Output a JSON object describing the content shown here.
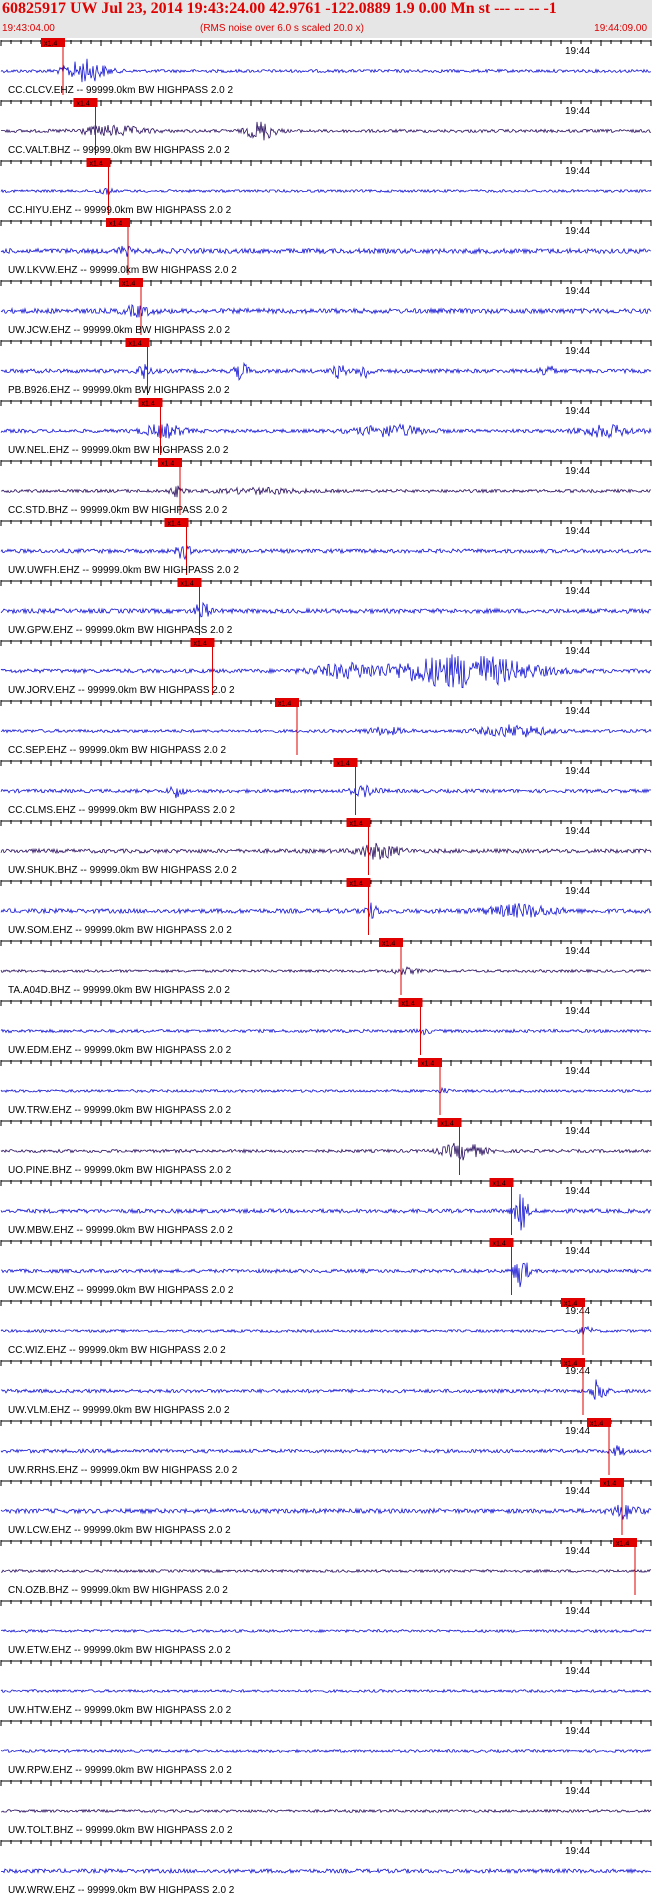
{
  "header": {
    "title": "60825917 UW Jul 23, 2014 19:43:24.00   42.9761 -122.0889  1.9 0.00 Mn st --- -- --  -1",
    "start_time": "19:43:04.00",
    "note": "(RMS noise over 6.0 s scaled 20.0 x)",
    "end_time": "19:44:09.00"
  },
  "time_marker": "19:44",
  "pick_label": "x1.4",
  "colors": {
    "header_text": "#e00000",
    "header_bg": "#e6e6e6",
    "blue": "#1414d2",
    "dark": "#2a1060",
    "pick": "#e00000"
  },
  "traces": [
    {
      "label": "CC.CLCV.EHZ -- 99999.0km BW  HIGHPASS  2.0  2",
      "color": "blue",
      "pick": 0.08,
      "amp": 0.35,
      "bursts": [
        [
          0.13,
          0.03,
          7
        ]
      ]
    },
    {
      "label": "CC.VALT.BHZ -- 99999.0km BW  HIGHPASS  2.0  2",
      "color": "dark",
      "pick": 0.13,
      "amp": 0.35,
      "bursts": [
        [
          0.17,
          0.05,
          3
        ],
        [
          0.4,
          0.02,
          6
        ]
      ]
    },
    {
      "label": "CC.HIYU.EHZ -- 99999.0km BW  HIGHPASS  2.0  2",
      "color": "blue",
      "pick": 0.15,
      "amp": 0.3,
      "bursts": [
        [
          0.16,
          0.01,
          2.5
        ]
      ]
    },
    {
      "label": "UW.LKVW.EHZ -- 99999.0km BW  HIGHPASS  2.0  2",
      "color": "blue",
      "pick": 0.18,
      "amp": 0.55,
      "bursts": [
        [
          0.19,
          0.01,
          1.5
        ]
      ]
    },
    {
      "label": "UW.JCW.EHZ -- 99999.0km BW  HIGHPASS  2.0  2",
      "color": "blue",
      "pick": 0.2,
      "amp": 0.55,
      "bursts": [
        [
          0.21,
          0.02,
          1.8
        ]
      ]
    },
    {
      "label": "PB.B926.EHZ -- 99999.0km BW  HIGHPASS  2.0  2",
      "color": "blue",
      "pick": 0.21,
      "amp": 0.45,
      "bursts": [
        [
          0.22,
          0.01,
          3.5
        ],
        [
          0.37,
          0.01,
          4
        ],
        [
          0.52,
          0.01,
          3
        ],
        [
          0.56,
          0.01,
          3.5
        ],
        [
          0.84,
          0.01,
          3
        ]
      ]
    },
    {
      "label": "UW.NEL.EHZ -- 99999.0km BW  HIGHPASS  2.0  2",
      "color": "blue",
      "pick": 0.23,
      "amp": 0.4,
      "bursts": [
        [
          0.25,
          0.03,
          3.5
        ],
        [
          0.6,
          0.05,
          3
        ],
        [
          0.93,
          0.04,
          3
        ]
      ]
    },
    {
      "label": "CC.STD.BHZ -- 99999.0km BW  HIGHPASS  2.0  2",
      "color": "dark",
      "pick": 0.26,
      "amp": 0.35,
      "bursts": [
        [
          0.27,
          0.01,
          3
        ],
        [
          0.4,
          0.06,
          1.5
        ]
      ]
    },
    {
      "label": "UW.UWFH.EHZ -- 99999.0km BW  HIGHPASS  2.0  2",
      "color": "blue",
      "pick": 0.27,
      "amp": 0.45,
      "bursts": [
        [
          0.28,
          0.01,
          3.5
        ]
      ]
    },
    {
      "label": "UW.GPW.EHZ -- 99999.0km BW  HIGHPASS  2.0  2",
      "color": "blue",
      "pick": 0.29,
      "amp": 0.5,
      "bursts": [
        [
          0.31,
          0.01,
          4
        ]
      ]
    },
    {
      "label": "UW.JORV.EHZ -- 99999.0km BW  HIGHPASS  2.0  2",
      "color": "blue",
      "pick": 0.31,
      "amp": 0.45,
      "bursts": [
        [
          0.71,
          0.1,
          8
        ],
        [
          0.53,
          0.05,
          3
        ]
      ]
    },
    {
      "label": "CC.SEP.EHZ -- 99999.0km BW  HIGHPASS  2.0  2",
      "color": "blue",
      "pick": 0.44,
      "amp": 0.35,
      "bursts": [
        [
          0.79,
          0.05,
          3.5
        ],
        [
          0.59,
          0.03,
          2
        ]
      ]
    },
    {
      "label": "CC.CLMS.EHZ -- 99999.0km BW  HIGHPASS  2.0  2",
      "color": "blue",
      "pick": 0.53,
      "amp": 0.4,
      "bursts": [
        [
          0.27,
          0.01,
          3.5
        ],
        [
          0.56,
          0.02,
          2.5
        ]
      ]
    },
    {
      "label": "UW.SHUK.BHZ -- 99999.0km BW  HIGHPASS  2.0  2",
      "color": "dark",
      "pick": 0.55,
      "amp": 0.45,
      "bursts": [
        [
          0.58,
          0.03,
          3.5
        ]
      ]
    },
    {
      "label": "UW.SOM.EHZ -- 99999.0km BW  HIGHPASS  2.0  2",
      "color": "blue",
      "pick": 0.55,
      "amp": 0.5,
      "bursts": [
        [
          0.57,
          0.01,
          3
        ],
        [
          0.8,
          0.05,
          2.5
        ]
      ]
    },
    {
      "label": "TA.A04D.BHZ -- 99999.0km BW  HIGHPASS  2.0  2",
      "color": "dark",
      "pick": 0.6,
      "amp": 0.3,
      "bursts": [
        [
          0.62,
          0.02,
          2
        ]
      ]
    },
    {
      "label": "UW.EDM.EHZ -- 99999.0km BW  HIGHPASS  2.0  2",
      "color": "blue",
      "pick": 0.63,
      "amp": 0.35,
      "bursts": [
        [
          0.65,
          0.01,
          1.5
        ]
      ]
    },
    {
      "label": "UW.TRW.EHZ -- 99999.0km BW  HIGHPASS  2.0  2",
      "color": "blue",
      "pick": 0.66,
      "amp": 0.3,
      "bursts": [
        [
          0.68,
          0.01,
          1.5
        ]
      ]
    },
    {
      "label": "UO.PINE.BHZ -- 99999.0km BW  HIGHPASS  2.0  2",
      "color": "dark",
      "pick": 0.69,
      "amp": 0.35,
      "bursts": [
        [
          0.71,
          0.03,
          5
        ]
      ]
    },
    {
      "label": "UW.MBW.EHZ -- 99999.0km BW  HIGHPASS  2.0  2",
      "color": "blue",
      "pick": 0.77,
      "amp": 0.45,
      "bursts": [
        [
          0.8,
          0.01,
          9
        ]
      ]
    },
    {
      "label": "UW.MCW.EHZ -- 99999.0km BW  HIGHPASS  2.0  2",
      "color": "blue",
      "pick": 0.77,
      "amp": 0.4,
      "bursts": [
        [
          0.8,
          0.01,
          9
        ]
      ]
    },
    {
      "label": "CC.WIZ.EHZ -- 99999.0km BW  HIGHPASS  2.0  2",
      "color": "blue",
      "pick": 0.88,
      "amp": 0.3,
      "bursts": [
        [
          0.9,
          0.01,
          3
        ]
      ]
    },
    {
      "label": "UW.VLM.EHZ -- 99999.0km BW  HIGHPASS  2.0  2",
      "color": "blue",
      "pick": 0.88,
      "amp": 0.4,
      "bursts": [
        [
          0.92,
          0.01,
          8
        ]
      ]
    },
    {
      "label": "UW.RRHS.EHZ -- 99999.0km BW  HIGHPASS  2.0  2",
      "color": "blue",
      "pick": 0.92,
      "amp": 0.4,
      "bursts": [
        [
          0.95,
          0.01,
          2.5
        ]
      ]
    },
    {
      "label": "UW.LCW.EHZ -- 99999.0km BW  HIGHPASS  2.0  2",
      "color": "blue",
      "pick": 0.94,
      "amp": 0.5,
      "bursts": [
        [
          0.96,
          0.02,
          3
        ]
      ]
    },
    {
      "label": "CN.OZB.BHZ -- 99999.0km BW  HIGHPASS  2.0  2",
      "color": "dark",
      "pick": 0.96,
      "amp": 0.3,
      "bursts": []
    },
    {
      "label": "UW.ETW.EHZ -- 99999.0km BW  HIGHPASS  2.0  2",
      "color": "blue",
      "pick": null,
      "amp": 0.3,
      "bursts": []
    },
    {
      "label": "UW.HTW.EHZ -- 99999.0km BW  HIGHPASS  2.0  2",
      "color": "blue",
      "pick": null,
      "amp": 0.3,
      "bursts": []
    },
    {
      "label": "UW.RPW.EHZ -- 99999.0km BW  HIGHPASS  2.0  2",
      "color": "blue",
      "pick": null,
      "amp": 0.3,
      "bursts": []
    },
    {
      "label": "UW.TOLT.BHZ -- 99999.0km BW  HIGHPASS  2.0  2",
      "color": "dark",
      "pick": null,
      "amp": 0.3,
      "bursts": []
    },
    {
      "label": "UW.WRW.EHZ -- 99999.0km BW  HIGHPASS  2.0  2",
      "color": "blue",
      "pick": null,
      "amp": 0.45,
      "bursts": []
    }
  ]
}
